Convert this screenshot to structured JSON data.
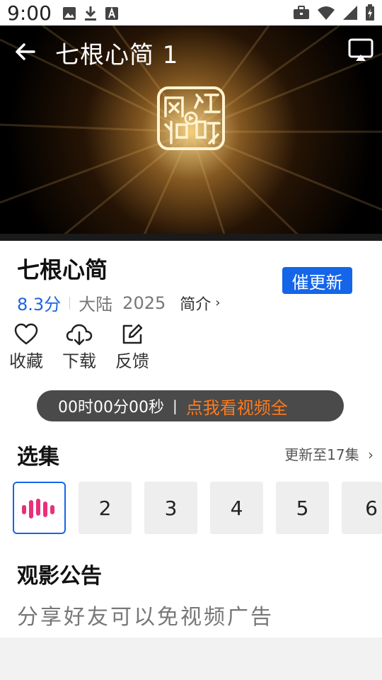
{
  "status_bar": {
    "time": "9:00",
    "left_icons": [
      "image-icon",
      "download-icon",
      "text-a-icon"
    ],
    "right_icons": [
      "briefcase-icon",
      "wifi-icon",
      "signal-icon",
      "battery-icon"
    ]
  },
  "video": {
    "title": "七根心简 1",
    "logo_text": "网络视听",
    "icons": [
      "back-arrow-icon",
      "cast-icon"
    ]
  },
  "show": {
    "title": "七根心简",
    "score": "8.3分",
    "region": "大陆",
    "year": "2025",
    "intro_label": "简介",
    "urge_button": "催更新"
  },
  "actions": [
    {
      "label": "收藏",
      "icon": "heart-icon"
    },
    {
      "label": "下载",
      "icon": "cloud-download-icon"
    },
    {
      "label": "反馈",
      "icon": "edit-icon"
    }
  ],
  "ad_banner": {
    "timer": "00时00分00秒",
    "separator": "|",
    "link": "点我看视频全"
  },
  "episodes_section": {
    "title": "选集",
    "update_info": "更新至17集",
    "items": [
      "1",
      "2",
      "3",
      "4",
      "5",
      "6"
    ],
    "active_index": 0
  },
  "notice_section": {
    "title": "观影公告",
    "text": "分享好友可以免视频广告"
  },
  "colors": {
    "accent_blue": "#1565e8",
    "score_blue": "#1f63e0",
    "orange_link": "#ff7a1a",
    "active_bars_pink": "#e8307a"
  }
}
